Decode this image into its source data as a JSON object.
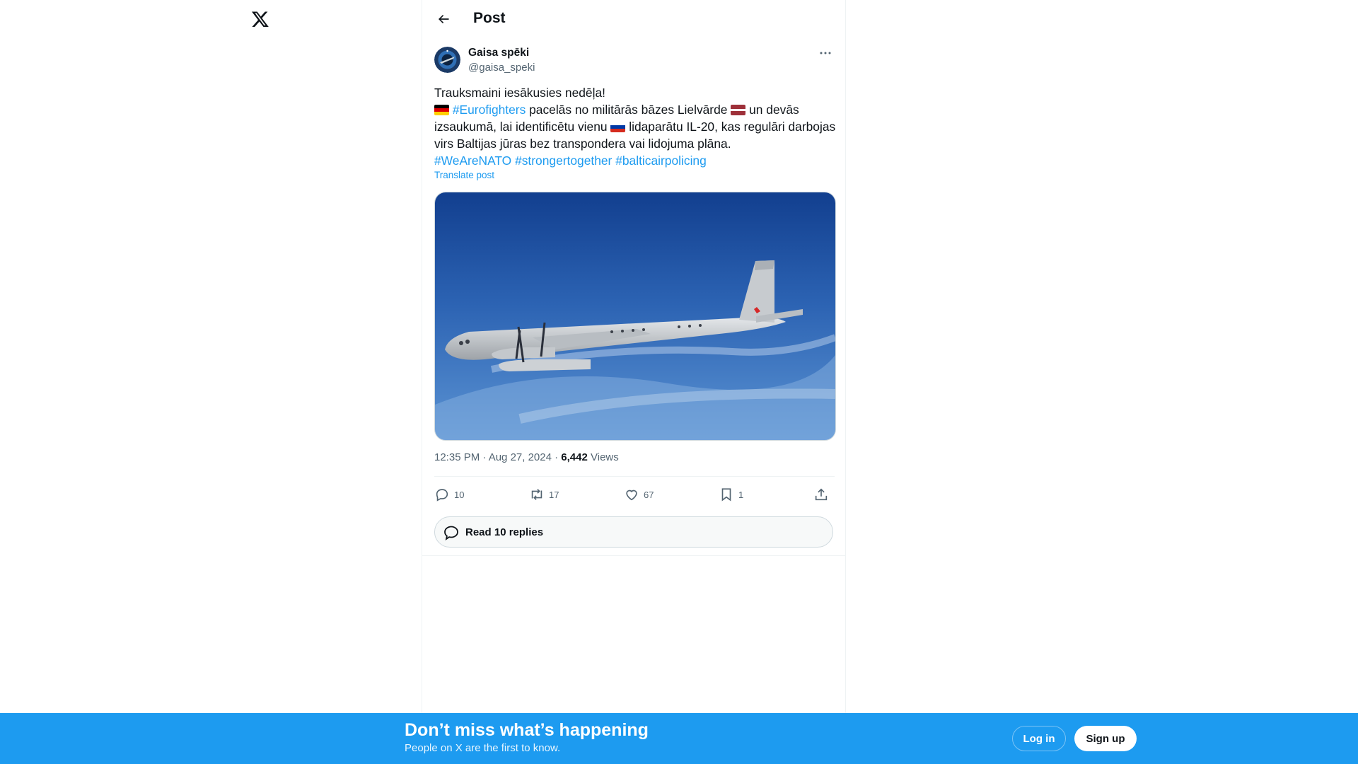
{
  "header": {
    "title": "Post"
  },
  "post": {
    "author_name": "Gaisa spēki",
    "author_handle": "@gaisa_speki",
    "text_line1": "Trauksmaini iesākusies nedēļa!",
    "hashtag_eurofighters": "#Eurofighters",
    "text_seg2": " pacelās no militārās bāzes Lielvārde ",
    "text_seg3": " un devās izsaukumā, lai identificētu vienu ",
    "text_seg4": " lidaparātu IL-20, kas regulāri darbojas virs Baltijas jūras bez transpondera vai lidojuma plāna.",
    "hashtags": [
      "#WeAreNATO",
      "#strongertogether",
      "#balticairpolicing"
    ],
    "translate_label": "Translate post",
    "timestamp": "12:35 PM · Aug 27, 2024 · ",
    "views_count": "6,442",
    "views_label": " Views"
  },
  "actions": {
    "replies": "10",
    "reposts": "17",
    "likes": "67",
    "bookmarks": "1"
  },
  "read_replies_label": "Read 10 replies",
  "banner": {
    "title": "Don’t miss what’s happening",
    "subtitle": "People on X are the first to know.",
    "login_label": "Log in",
    "signup_label": "Sign up"
  },
  "colors": {
    "accent": "#1d9bf0",
    "text_secondary": "#536471",
    "banner_bg": "#1d9bf0"
  },
  "icons": [
    "x-logo-icon",
    "back-arrow-icon",
    "more-icon",
    "reply-icon",
    "repost-icon",
    "like-icon",
    "bookmark-icon",
    "share-icon",
    "replies-bubble-icon",
    "flag-germany-icon",
    "flag-latvia-icon",
    "flag-russia-icon"
  ]
}
